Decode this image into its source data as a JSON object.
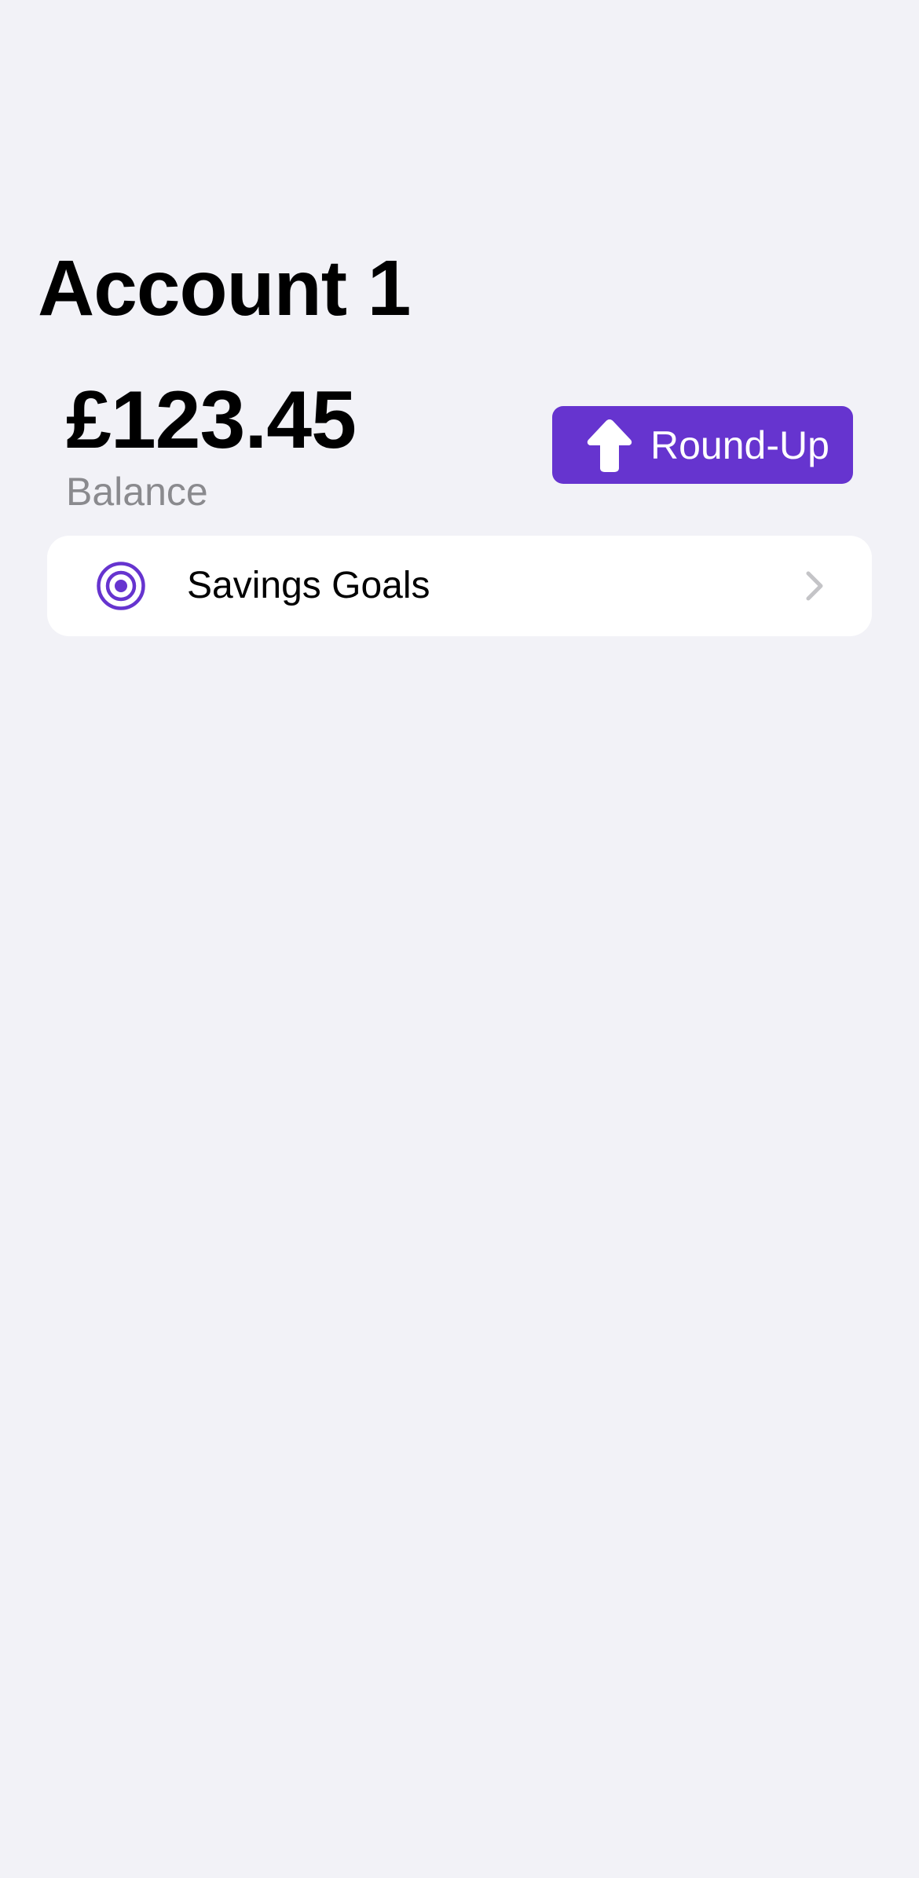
{
  "account": {
    "title": "Account 1",
    "balance": "£123.45",
    "balance_label": "Balance"
  },
  "actions": {
    "roundup_label": "Round-Up",
    "roundup_icon": "arrow-up-icon"
  },
  "menu": {
    "items": [
      {
        "label": "Savings Goals",
        "icon": "target-icon",
        "accessory": "chevron-right-icon"
      }
    ]
  },
  "colors": {
    "accent": "#6634cf",
    "background": "#f2f2f7",
    "card": "#ffffff",
    "secondary_text": "#8a8a8e",
    "chevron": "#c4c4c7"
  }
}
